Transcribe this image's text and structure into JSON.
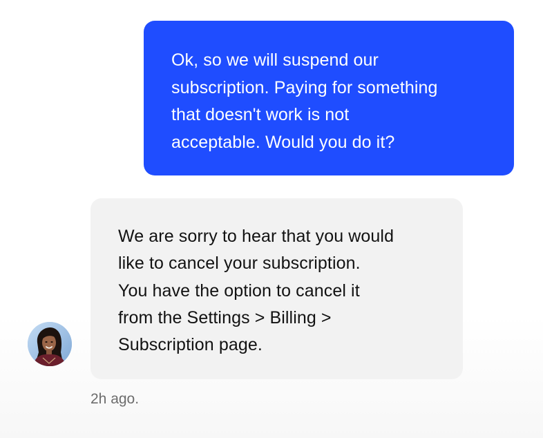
{
  "conversation": {
    "user_message": {
      "lines": [
        "Ok, so we will suspend our",
        "subscription. Paying for something",
        "that doesn't work is not",
        "acceptable. Would you do it?"
      ]
    },
    "agent_message": {
      "lines": [
        "We are sorry to hear that you would",
        "like to cancel your subscription.",
        "You have the option to cancel it",
        "from the Settings > Billing >",
        "Subscription page."
      ],
      "timestamp": "2h ago."
    }
  },
  "colors": {
    "user_bubble": "#1f4dff",
    "agent_bubble": "#f2f2f2",
    "user_text": "#ffffff",
    "agent_text": "#121212",
    "timestamp_text": "#6c6c6c"
  },
  "icons": {
    "agent_avatar": "agent-avatar-photo"
  }
}
